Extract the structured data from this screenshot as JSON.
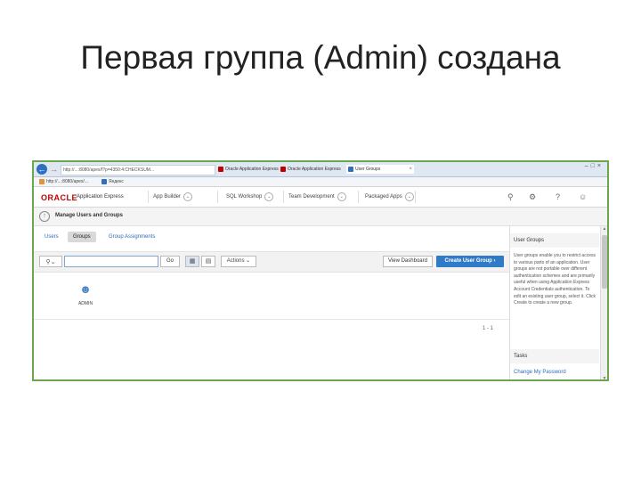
{
  "slide": {
    "title": "Первая группа (Admin) создана"
  },
  "browser": {
    "url": "http://...:8080/apex/f?p=4350:4:CHECKSUM...",
    "tabs": [
      {
        "label": "Oracle Application Express",
        "icon_color": "#c00000"
      },
      {
        "label": "Oracle Application Express",
        "icon_color": "#c00000"
      },
      {
        "label": "User Groups",
        "icon_color": "#2f6fbf"
      }
    ],
    "favorites": [
      {
        "label": "http://...:8080/apex/...",
        "icon_color": "#e69138"
      },
      {
        "label": "Яндекс",
        "icon_color": "#2f6fbf"
      }
    ]
  },
  "apex": {
    "logo_oracle": "ORACLE",
    "logo_product": "Application Express",
    "menus": [
      {
        "label": "App Builder"
      },
      {
        "label": "SQL Workshop"
      },
      {
        "label": "Team Development"
      },
      {
        "label": "Packaged Apps"
      }
    ],
    "page_title": "Manage Users and Groups",
    "tabs": [
      {
        "label": "Users",
        "active": false
      },
      {
        "label": "Groups",
        "active": true
      },
      {
        "label": "Group Assignments",
        "active": false
      }
    ],
    "toolbar": {
      "search_placeholder": "",
      "go_label": "Go",
      "actions_label": "Actions",
      "dashboard_label": "View Dashboard",
      "create_label": "Create User Group"
    },
    "groups": [
      {
        "name": "ADMIN"
      }
    ],
    "pager": "1 - 1",
    "side_panel": {
      "title": "User Groups",
      "text": "User groups enable you to restrict access to various parts of an application. User groups are not portable over different authentication schemes and are primarily useful when using Application Express Account Credentials authentication. To edit an existing user group, select it. Click Create to create a new group.",
      "tasks_title": "Tasks",
      "task_link": "Change My Password"
    }
  },
  "colors": {
    "accent": "#2f7bc8",
    "brand": "#c00000",
    "frame": "#6aa84f"
  }
}
